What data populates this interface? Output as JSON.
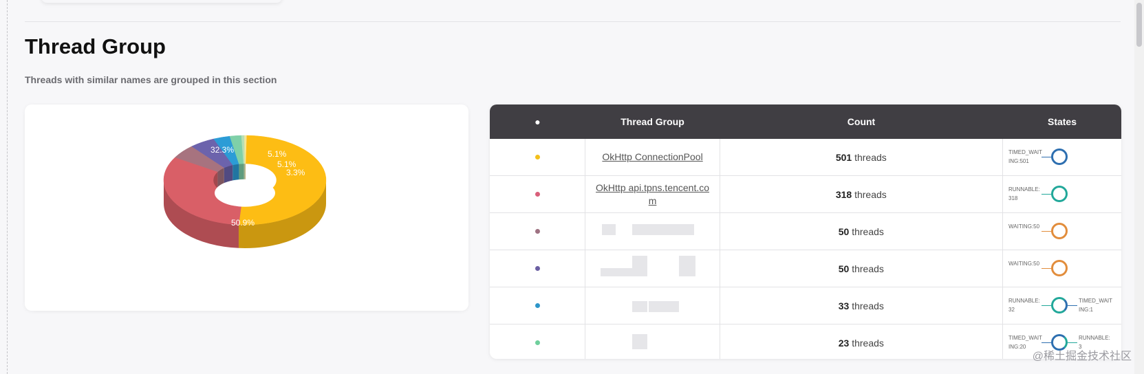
{
  "section": {
    "title": "Thread Group",
    "subtitle": "Threads with similar names are grouped in this section"
  },
  "chart_data": {
    "type": "pie",
    "title": "",
    "labels": [
      "OkHttp ConnectionPool",
      "OkHttp api.tpns.tencent.com",
      "",
      "",
      "",
      "",
      "",
      ""
    ],
    "values": [
      50.9,
      32.3,
      5.1,
      5.1,
      3.3,
      2.3,
      0.6,
      0.4
    ],
    "data_labels": [
      "50.9%",
      "32.3%",
      "5.1%",
      "5.1%",
      "3.3%",
      "",
      "",
      ""
    ],
    "colors": [
      "#fdbd14",
      "#d95f67",
      "#a7737f",
      "#6c63ac",
      "#2c9cd6",
      "#7fd0a8",
      "#b7dfb4",
      "#f3e79b"
    ]
  },
  "table": {
    "headers": [
      "●",
      "Thread Group",
      "Count",
      "States"
    ],
    "rows": [
      {
        "color": "#f3c01b",
        "name": "OkHttp ConnectionPool",
        "count": "501",
        "unit": "threads",
        "states": [
          {
            "label": "TIMED_WAITING:501",
            "color": "#2e6fb0",
            "side": "left"
          }
        ]
      },
      {
        "color": "#d95f7a",
        "name": "OkHttp api.tpns.tencent.com",
        "count": "318",
        "unit": "threads",
        "states": [
          {
            "label": "RUNNABLE: 318",
            "color": "#22a89a",
            "side": "left"
          }
        ]
      },
      {
        "color": "#9e7282",
        "name": "",
        "count": "50",
        "unit": "threads",
        "states": [
          {
            "label": "WAITING:50",
            "color": "#e28d3c",
            "side": "left"
          }
        ]
      },
      {
        "color": "#6b5fa3",
        "name": "",
        "count": "50",
        "unit": "threads",
        "states": [
          {
            "label": "WAITING:50",
            "color": "#e28d3c",
            "side": "left"
          }
        ]
      },
      {
        "color": "#2d96c9",
        "name": "",
        "count": "33",
        "unit": "threads",
        "states": [
          {
            "label": "RUNNABLE: 32",
            "color": "#22a89a",
            "side": "left"
          },
          {
            "label": "TIMED_WAITING:1",
            "color": "#2e6fb0",
            "side": "right"
          }
        ]
      },
      {
        "color": "#6fcf9c",
        "name": "",
        "count": "23",
        "unit": "threads",
        "states": [
          {
            "label": "TIMED_WAITING:20",
            "color": "#2e6fb0",
            "side": "left"
          },
          {
            "label": "RUNNABLE: 3",
            "color": "#22a89a",
            "side": "right"
          }
        ]
      }
    ]
  },
  "watermark": "@稀土掘金技术社区"
}
